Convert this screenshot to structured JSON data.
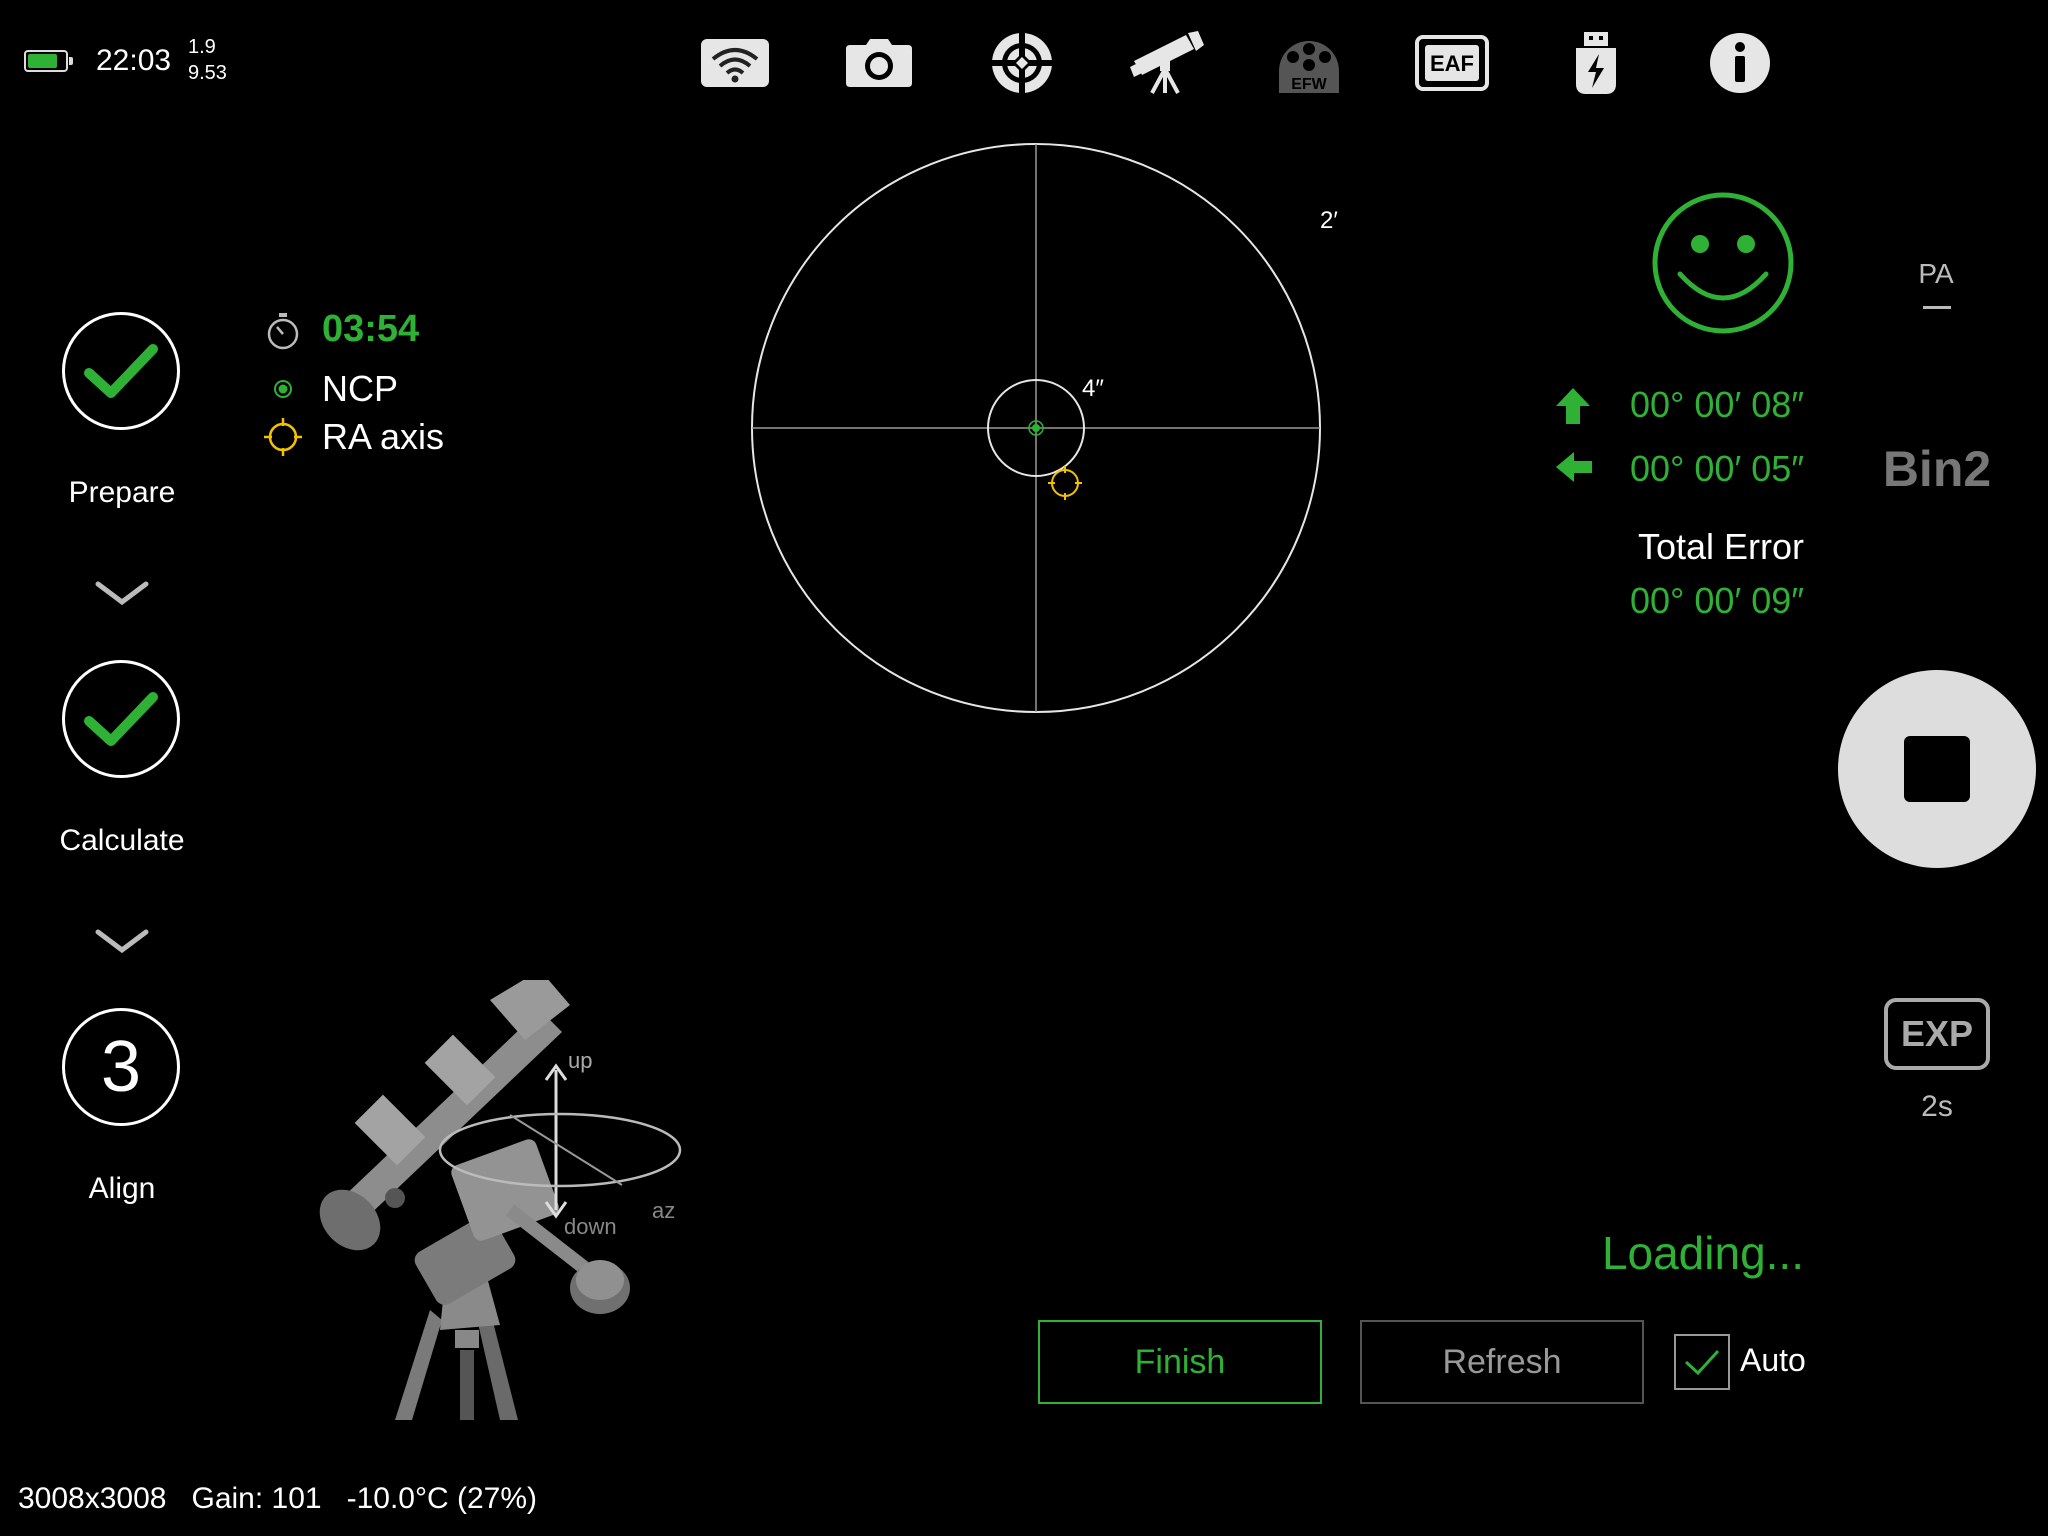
{
  "status": {
    "time": "22:03",
    "value_top": "1.9",
    "value_bottom": "9.53",
    "battery_level": 0.8,
    "battery_color": "#2eb135"
  },
  "toolbar": {
    "items": [
      {
        "name": "wifi-icon"
      },
      {
        "name": "camera-icon"
      },
      {
        "name": "guide-crosshair-icon"
      },
      {
        "name": "telescope-icon"
      },
      {
        "name": "efw-icon",
        "label": "EFW"
      },
      {
        "name": "eaf-icon",
        "label": "EAF"
      },
      {
        "name": "usb-power-icon"
      },
      {
        "name": "info-icon"
      }
    ]
  },
  "steps": [
    {
      "label": "Prepare",
      "state": "done"
    },
    {
      "label": "Calculate",
      "state": "done"
    },
    {
      "label": "Align",
      "state": "current",
      "number": "3"
    }
  ],
  "legend": {
    "timer": "03:54",
    "ncp": "NCP",
    "ra_axis": "RA axis"
  },
  "target": {
    "outer_label": "2′",
    "inner_label": "4″"
  },
  "errors": {
    "up": "00° 00′ 08″",
    "left": "00° 00′ 05″",
    "total_label": "Total Error",
    "total": "00° 00′ 09″"
  },
  "rightbar": {
    "pa": "PA",
    "bin": "Bin2",
    "exp_label": "EXP",
    "exp_value": "2s"
  },
  "mount": {
    "up": "up",
    "down": "down",
    "az": "az"
  },
  "bottom": {
    "loading": "Loading...",
    "finish": "Finish",
    "refresh": "Refresh",
    "auto": "Auto",
    "auto_checked": true
  },
  "footer": {
    "text": "3008x3008   Gain: 101   -10.0°C (27%)"
  },
  "colors": {
    "accent": "#2eb135",
    "ra_marker": "#f2c200",
    "background": "#000000"
  }
}
